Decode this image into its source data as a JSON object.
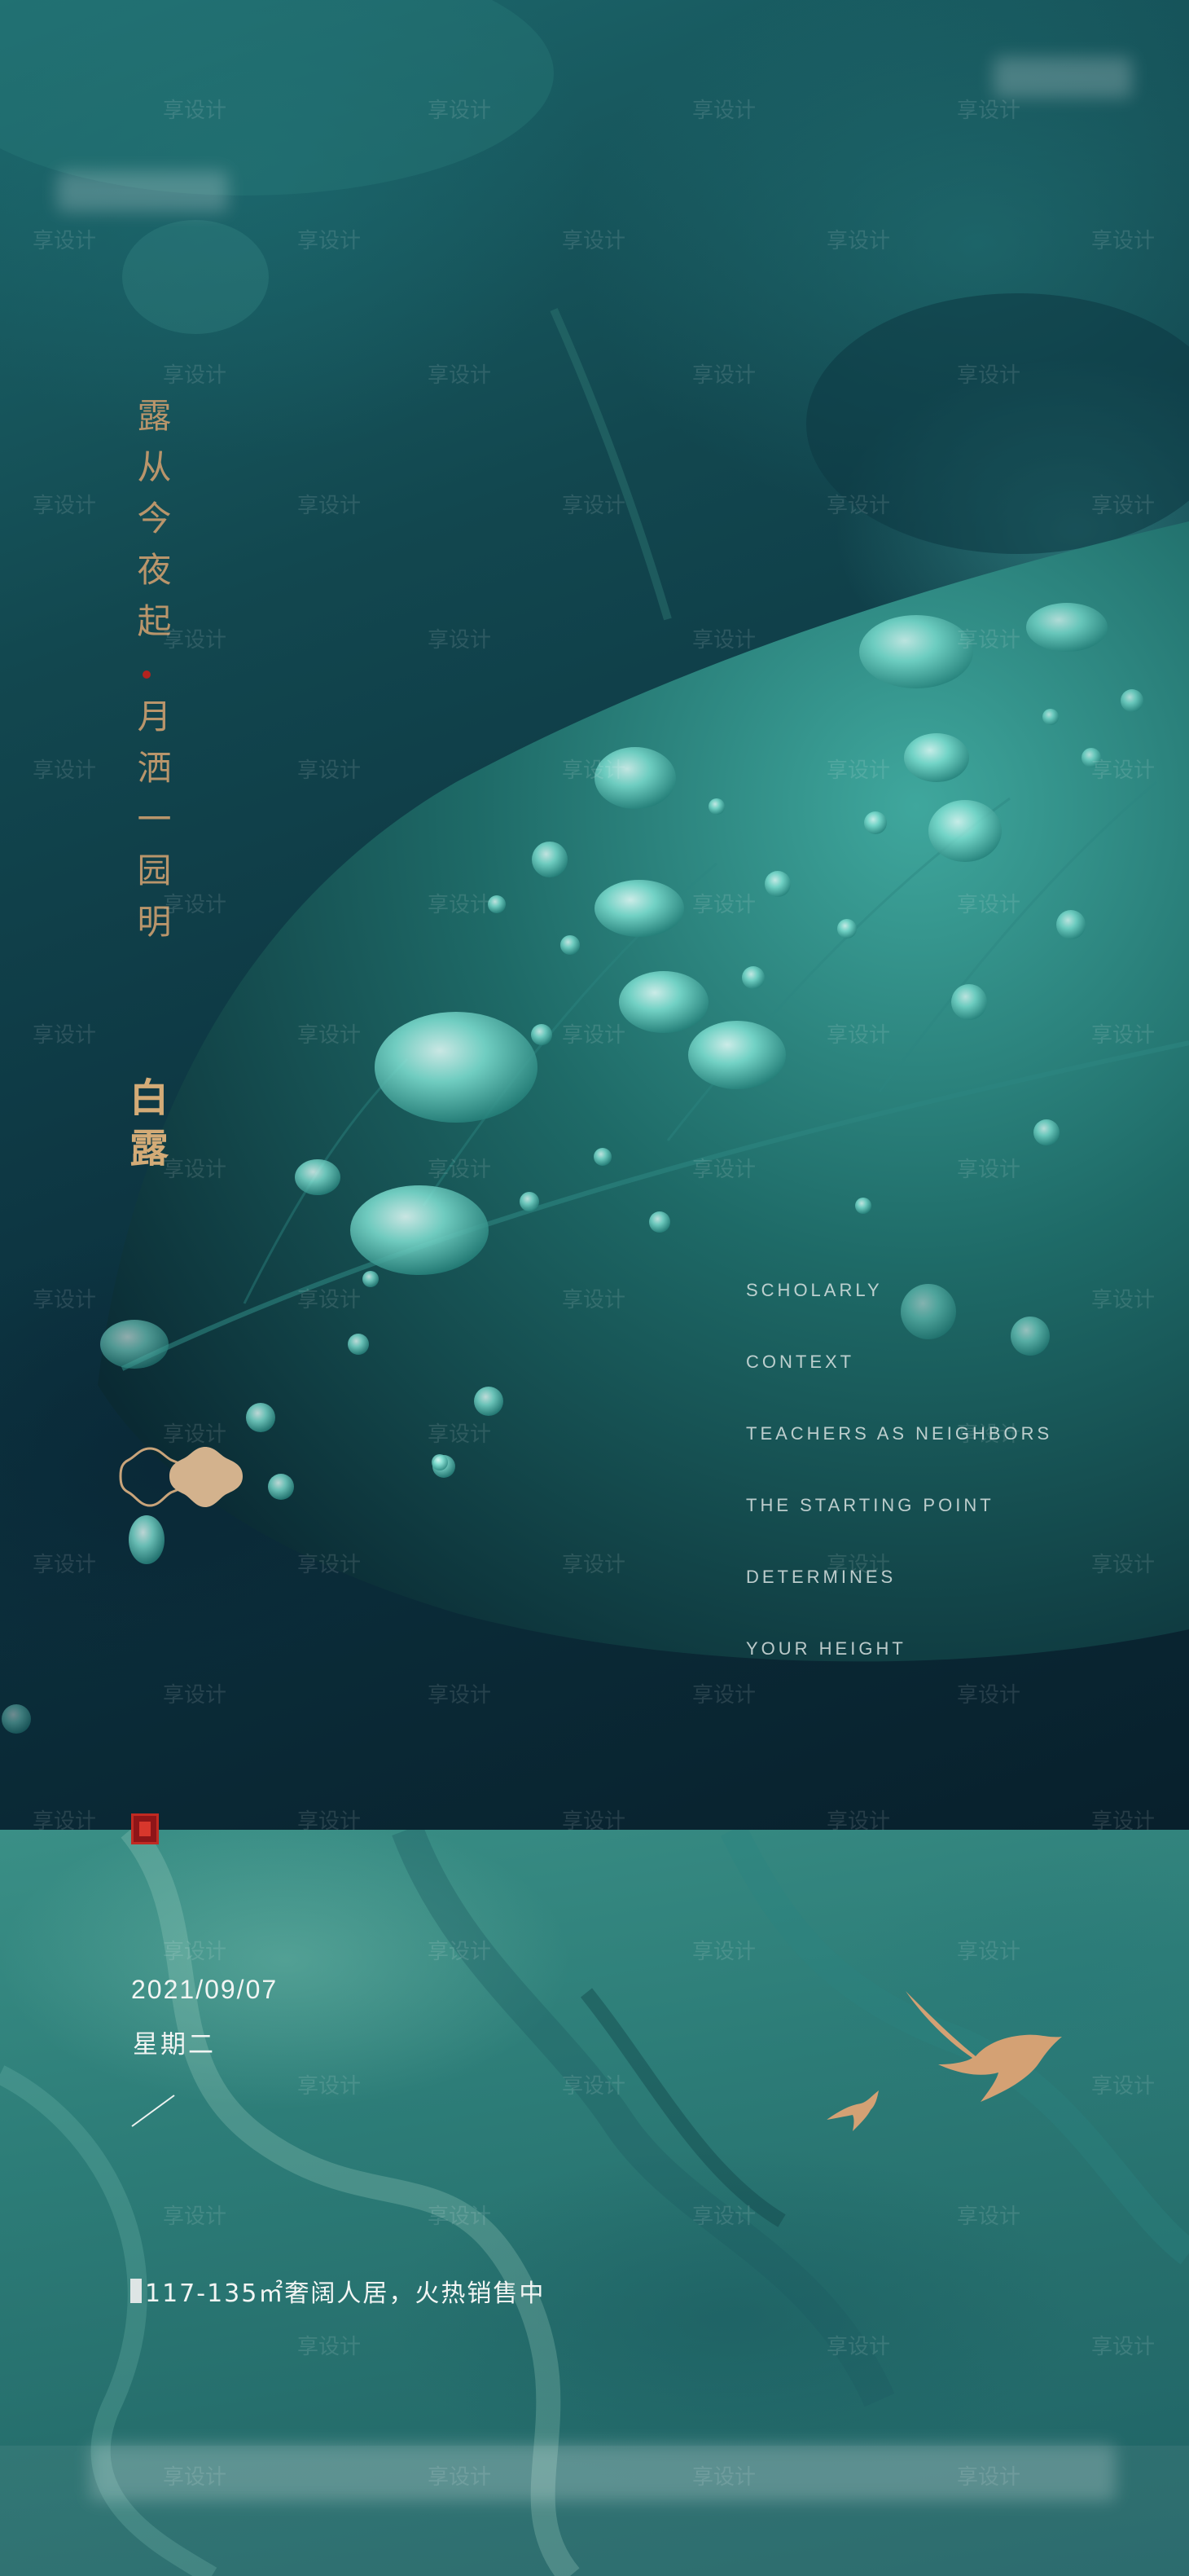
{
  "poem": {
    "line1": "露从今夜起",
    "line2": "月洒一园明"
  },
  "solar_term": "白露",
  "slogan": [
    "SCHOLARLY",
    "CONTEXT",
    "TEACHERS AS NEIGHBORS",
    "THE STARTING POINT",
    "DETERMINES",
    "YOUR HEIGHT"
  ],
  "date": "2021/09/07",
  "weekday": "星期二",
  "info": "117-135㎡奢阔人居，火热销售中",
  "watermark": "享设计",
  "colors": {
    "gold": "#b9956b",
    "teal_dark": "#0c3340",
    "teal_light": "#2d7d78",
    "seal_red": "#8e1518"
  }
}
